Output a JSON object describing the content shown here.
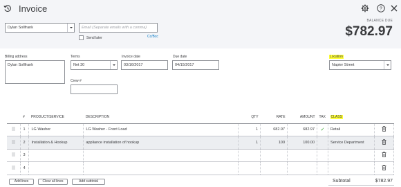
{
  "header": {
    "title": "Invoice",
    "balance_label": "BALANCE DUE",
    "balance_amount": "$782.97"
  },
  "customer": {
    "selected": "Dylan Sollfrank",
    "email_placeholder": "Email (Separate emails with a comma)",
    "send_later_label": "Send later",
    "cc_bcc_label": "Cc/Bcc"
  },
  "billing": {
    "label": "Billing address",
    "value": "Dylan Sollfrank"
  },
  "terms": {
    "label": "Terms",
    "value": "Net 30"
  },
  "invoice_date": {
    "label": "Invoice date",
    "value": "03/16/2017"
  },
  "due_date": {
    "label": "Due date",
    "value": "04/15/2017"
  },
  "crew": {
    "label": "Crew #",
    "value": ""
  },
  "location": {
    "label": "Location",
    "value": "Napier Street"
  },
  "table": {
    "headers": {
      "num": "#",
      "product": "PRODUCT/SERVICE",
      "description": "DESCRIPTION",
      "qty": "QTY",
      "rate": "RATE",
      "amount": "AMOUNT",
      "tax": "TAX",
      "class": "CLASS"
    },
    "rows": [
      {
        "num": "1",
        "product": "LG Washer",
        "description": "LG Washer - Front Load",
        "qty": "1",
        "rate": "682.97",
        "amount": "682.97",
        "tax": "✓",
        "class": "Retail"
      },
      {
        "num": "2",
        "product": "Installation & Hookup",
        "description": "appliance installation of hookup",
        "qty": "1",
        "rate": "100",
        "amount": "100.00",
        "tax": "",
        "class": "Service Department"
      },
      {
        "num": "3",
        "product": "",
        "description": "",
        "qty": "",
        "rate": "",
        "amount": "",
        "tax": "",
        "class": ""
      },
      {
        "num": "4",
        "product": "",
        "description": "",
        "qty": "",
        "rate": "",
        "amount": "",
        "tax": "",
        "class": ""
      }
    ]
  },
  "buttons": {
    "add_lines": "Add lines",
    "clear_all_lines": "Clear all lines",
    "add_subtotal": "Add subtotal"
  },
  "subtotal": {
    "label": "Subtotal",
    "value": "$782.97"
  },
  "colors": {
    "highlight": "#ffff3a",
    "link": "#0077c5",
    "check": "#2ca01c"
  }
}
